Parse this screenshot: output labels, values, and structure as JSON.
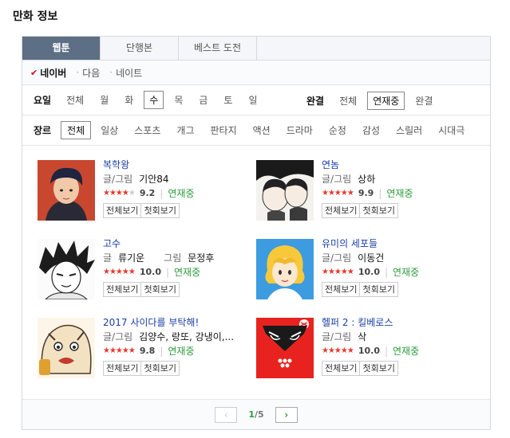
{
  "page_title": "만화 정보",
  "tabs": [
    {
      "label": "웹툰",
      "active": true
    },
    {
      "label": "단행본",
      "active": false
    },
    {
      "label": "베스트 도전",
      "active": false
    }
  ],
  "sources": [
    {
      "label": "네이버",
      "active": true
    },
    {
      "label": "다음",
      "active": false
    },
    {
      "label": "네이트",
      "active": false
    }
  ],
  "day_filter": {
    "label": "요일",
    "items": [
      "전체",
      "월",
      "화",
      "수",
      "목",
      "금",
      "토",
      "일"
    ],
    "selected": "수"
  },
  "status_filter": {
    "label": "완결",
    "items": [
      "전체",
      "연재중",
      "완결"
    ],
    "selected": "연재중"
  },
  "genre_filter": {
    "label": "장르",
    "items": [
      "전체",
      "일상",
      "스포츠",
      "개그",
      "판타지",
      "액션",
      "드라마",
      "순정",
      "감성",
      "스릴러",
      "시대극"
    ],
    "selected": "전체"
  },
  "comics": [
    {
      "title": "복학왕",
      "author_role": "글/그림",
      "author": "기안84",
      "role2": "",
      "author2": "",
      "score": "9.2",
      "rating": 4.6,
      "status": "연재중"
    },
    {
      "title": "연놈",
      "author_role": "글/그림",
      "author": "상하",
      "role2": "",
      "author2": "",
      "score": "9.9",
      "rating": 5,
      "status": "연재중"
    },
    {
      "title": "고수",
      "author_role": "글",
      "author": "류기운",
      "role2": "그림",
      "author2": "문정후",
      "score": "10.0",
      "rating": 5,
      "status": "연재중"
    },
    {
      "title": "유미의 세포들",
      "author_role": "글/그림",
      "author": "이동건",
      "role2": "",
      "author2": "",
      "score": "10.0",
      "rating": 5,
      "status": "연재중"
    },
    {
      "title": "2017 사이다를 부탁해!",
      "author_role": "글/그림",
      "author": "김양수, 랑또, 강냉이,...",
      "role2": "",
      "author2": "",
      "score": "9.8",
      "rating": 5,
      "status": "연재중"
    },
    {
      "title": "헬퍼 2 : 킬베로스",
      "author_role": "글/그림",
      "author": "삭",
      "role2": "",
      "author2": "",
      "score": "10.0",
      "rating": 5,
      "status": "연재중"
    }
  ],
  "buttons": {
    "view_all": "전체보기",
    "first_episode": "첫회보기"
  },
  "pager": {
    "current": "1",
    "separator": "/",
    "total": "5"
  },
  "colors": {
    "accent_red": "#e8382b",
    "status_green": "#2a9d3a",
    "title_blue": "#1a3fa6",
    "tab_active": "#5d6f85"
  }
}
